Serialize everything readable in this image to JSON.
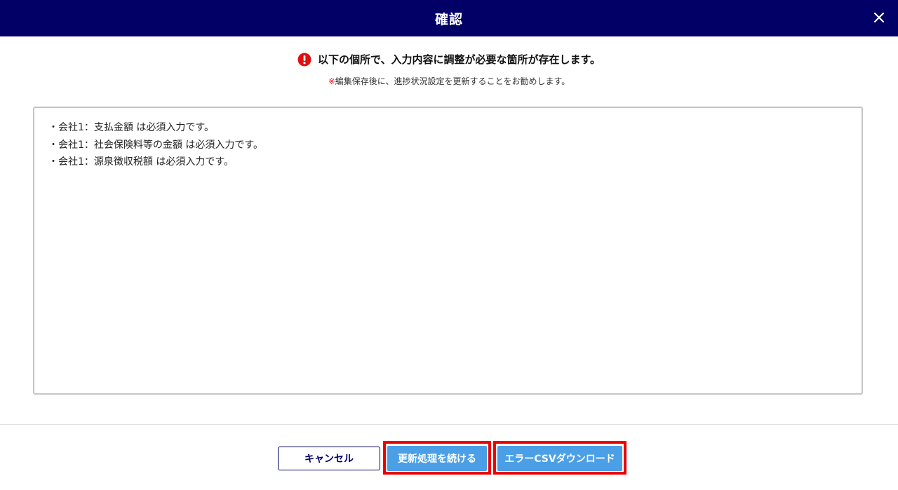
{
  "dialog": {
    "title": "確認",
    "close_icon": "close-icon"
  },
  "alert": {
    "icon": "exclamation-circle-icon",
    "icon_color": "#e01010",
    "message": "以下の個所で、入力内容に調整が必要な箇所が存在します。",
    "note_mark": "※",
    "note_text": "編集保存後に、進捗状況設定を更新することをお勧めします。"
  },
  "errors": [
    "・会社1：支払金額 は必須入力です。",
    "・会社1：社会保険料等の金額 は必須入力です。",
    "・会社1：源泉徴収税額 は必須入力です。"
  ],
  "footer": {
    "cancel_label": "キャンセル",
    "continue_label": "更新処理を続ける",
    "csv_label": "エラーCSVダウンロード"
  },
  "colors": {
    "header_bg": "#020066",
    "primary_button": "#4b9fe6",
    "highlight_outline": "#ee0000"
  }
}
